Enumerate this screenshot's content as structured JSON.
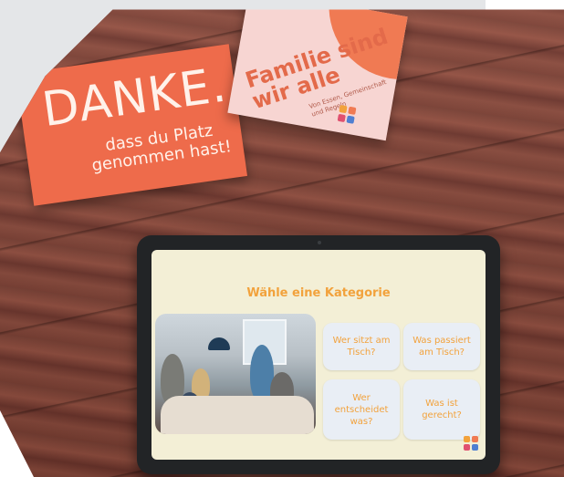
{
  "photo": {
    "card_danke": {
      "headline": "DANKE.",
      "line": "dass du Platz genommen hast!"
    },
    "card_familie": {
      "title": "Familie sind wir alle",
      "subtitle": "Von Essen, Gemeinschaft und Regeln",
      "logo_icon": "family-logo-icon"
    },
    "tablet": {
      "screen": {
        "heading": "Wähle eine Kategorie",
        "categories": [
          "Wer sitzt am Tisch?",
          "Was passiert am Tisch?",
          "Wer entscheidet was?",
          "Was ist gerecht?"
        ],
        "image_icon": "family-dinner-photo",
        "brand_icon": "brand-logo-icon"
      }
    }
  },
  "colors": {
    "coral": "#ee6b4b",
    "pink": "#f7d5d2",
    "accent": "#f2a23c",
    "logo": [
      "#f2a23c",
      "#f07a53",
      "#e0506f",
      "#4f7fd1"
    ]
  }
}
